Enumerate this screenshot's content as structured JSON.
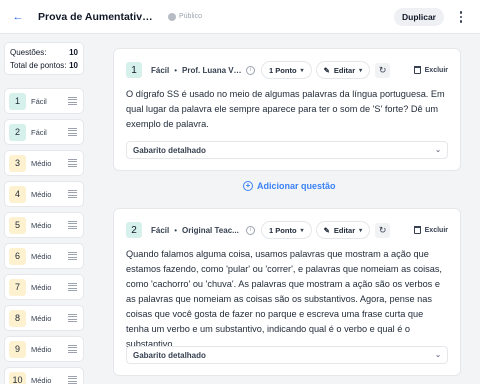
{
  "header": {
    "title": "Prova de Aumentativo e Di...",
    "visibility": "Público",
    "duplicate_label": "Duplicar"
  },
  "summary": {
    "questions_label": "Questões:",
    "questions_value": "10",
    "points_label": "Total de pontos:",
    "points_value": "10"
  },
  "sidebar": {
    "items": [
      {
        "num": "1",
        "label": "Fácil",
        "color": "#d6f0ec"
      },
      {
        "num": "2",
        "label": "Fácil",
        "color": "#d6f0ec"
      },
      {
        "num": "3",
        "label": "Médio",
        "color": "#fdf1cf"
      },
      {
        "num": "4",
        "label": "Médio",
        "color": "#fdf1cf"
      },
      {
        "num": "5",
        "label": "Médio",
        "color": "#fdf1cf"
      },
      {
        "num": "6",
        "label": "Médio",
        "color": "#fdf1cf"
      },
      {
        "num": "7",
        "label": "Médio",
        "color": "#fdf1cf"
      },
      {
        "num": "8",
        "label": "Médio",
        "color": "#fdf1cf"
      },
      {
        "num": "9",
        "label": "Médio",
        "color": "#fdf1cf"
      },
      {
        "num": "10",
        "label": "Médio",
        "color": "#fdf1cf"
      }
    ]
  },
  "questions": [
    {
      "num": "1",
      "difficulty": "Fácil",
      "author": "Prof. Luana Vi...",
      "points": "1 Ponto",
      "edit": "Editar",
      "delete": "Excluir",
      "text": "O dígrafo SS é usado no meio de algumas palavras da língua portuguesa. Em qual lugar da palavra ele sempre aparece para ter o som de 'S' forte? Dê um exemplo de palavra.",
      "answer": "Gabarito detalhado"
    },
    {
      "num": "2",
      "difficulty": "Fácil",
      "author": "Original Teac...",
      "points": "1 Ponto",
      "edit": "Editar",
      "delete": "Excluir",
      "text": "Quando falamos alguma coisa, usamos palavras que mostram a ação que estamos fazendo, como 'pular' ou 'correr', e palavras que nomeiam as coisas, como 'cachorro' ou 'chuva'. As palavras que mostram a ação são os verbos e as palavras que nomeiam as coisas são os substantivos. Agora, pense nas coisas que você gosta de fazer no parque e escreva uma frase curta que tenha um verbo e um substantivo, indicando qual é o verbo e qual é o substantivo.",
      "answer": "Gabarito detalhado"
    }
  ],
  "add_question_label": "Adicionar questão"
}
